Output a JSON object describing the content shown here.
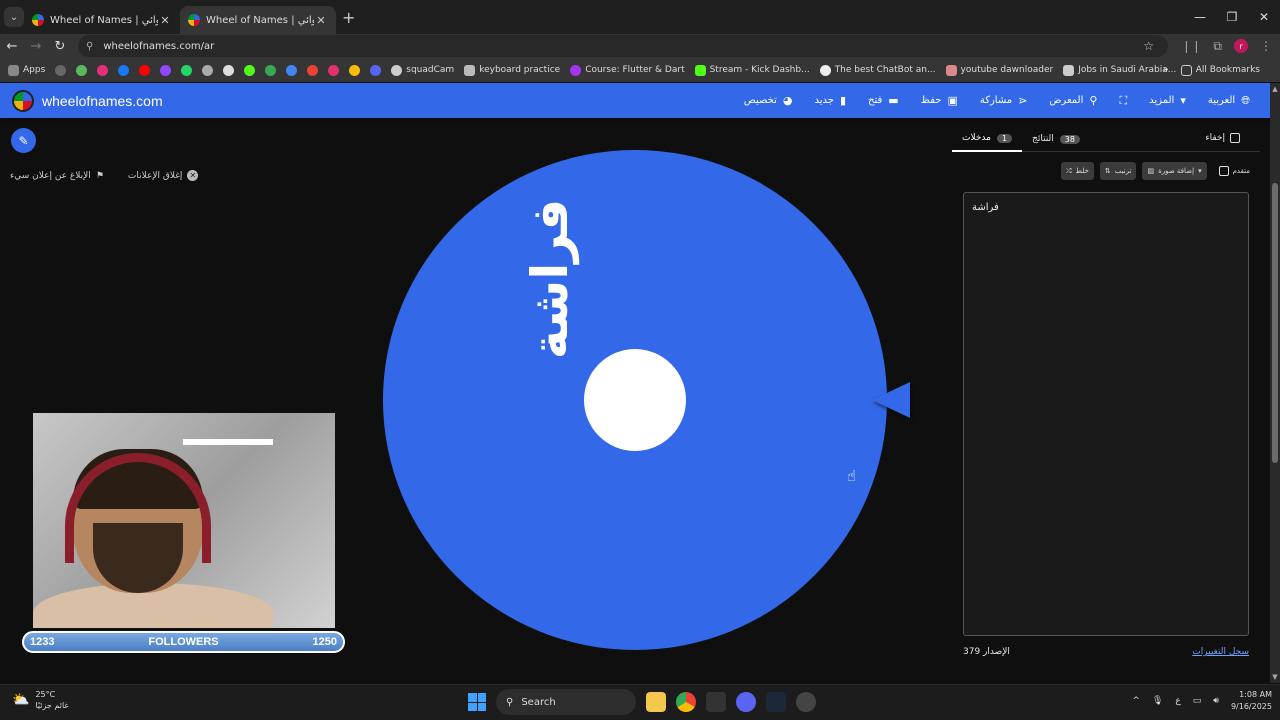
{
  "browser": {
    "tabs": [
      {
        "title": "Wheel of Names | اسم العشوائي"
      },
      {
        "title": "Wheel of Names | اسم العشوائي"
      }
    ],
    "url": "wheelofnames.com/ar",
    "bookmarks": [
      {
        "label": "Apps"
      },
      {
        "label": "squadCam"
      },
      {
        "label": "keyboard practice"
      },
      {
        "label": "Course: Flutter & Dart"
      },
      {
        "label": "Stream - Kick Dashb..."
      },
      {
        "label": "The best ChatBot an..."
      },
      {
        "label": "youtube dawnloader"
      },
      {
        "label": "Jobs in Saudi Arabia..."
      }
    ],
    "all_bookmarks_label": "All Bookmarks",
    "profile_initial": "r"
  },
  "header": {
    "site_name": "wheelofnames.com",
    "menu": [
      {
        "label": "العربية",
        "icon": "globe-icon"
      },
      {
        "label": "المزيد",
        "icon": "caret-down-icon"
      },
      {
        "label": "",
        "icon": "fullscreen-icon"
      },
      {
        "label": "المعرض",
        "icon": "search-icon"
      },
      {
        "label": "مشاركة",
        "icon": "share-icon"
      },
      {
        "label": "حفظ",
        "icon": "save-icon"
      },
      {
        "label": "فتح",
        "icon": "folder-icon"
      },
      {
        "label": "جديد",
        "icon": "file-icon"
      },
      {
        "label": "تخصيص",
        "icon": "palette-icon"
      }
    ]
  },
  "ads": {
    "close_ads": "إغلاق الإعلانات",
    "report_ad": "الإبلاغ عن إعلان سيء"
  },
  "wheel": {
    "entry_label": "فراشة",
    "color": "#3369e8"
  },
  "stream": {
    "followers_label": "FOLLOWERS",
    "current": "1233",
    "goal": "1250"
  },
  "panel": {
    "tab_entries": "مدخلات",
    "entries_count": "1",
    "tab_results": "النتائج",
    "results_count": "38",
    "hide_label": "إخفاء",
    "shuffle_label": "خلط",
    "sort_label": "ترتيب",
    "add_image_label": "إضافة صورة",
    "advanced_label": "متقدم",
    "entries_text": "فراشة",
    "version": "الإصدار 379",
    "changelog": "سجل التغييرات"
  },
  "taskbar": {
    "temperature": "25°C",
    "weather_desc": "غائم جزئيًا",
    "search_label": "Search",
    "lang": "ع",
    "time": "1:08 AM",
    "date": "9/16/2025"
  }
}
